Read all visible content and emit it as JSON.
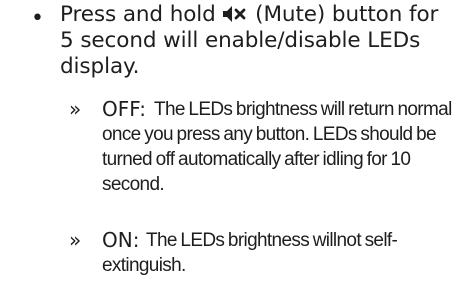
{
  "bullet_marker": "•",
  "main_item": {
    "text_before_icon": "Press and hold ",
    "icon": "mute-speaker-icon",
    "text_after_icon": " (Mute) button for 5 second will enable/disable LEDs display."
  },
  "sub_marker": "»",
  "sub_items": [
    {
      "label": "OFF:",
      "text": "The LEDs brightness will return normal once you press any button. LEDs should be turned off automatically after idling for 10 second."
    },
    {
      "label": "ON:",
      "text": "The LEDs brightness willnot self-extinguish."
    }
  ]
}
